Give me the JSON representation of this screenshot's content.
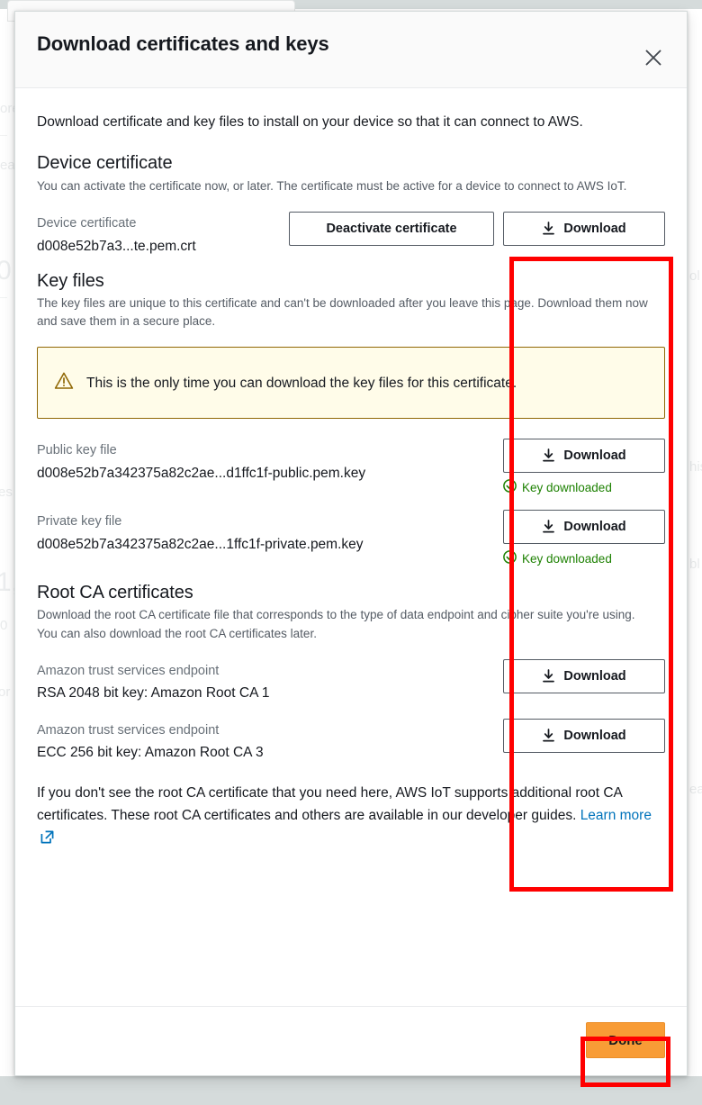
{
  "modal": {
    "title": "Download certificates and keys",
    "close_icon": "close-icon",
    "intro": "Download certificate and key files to install on your device so that it can connect to AWS."
  },
  "device_certificate": {
    "heading": "Device certificate",
    "description": "You can activate the certificate now, or later. The certificate must be active for a device to connect to AWS IoT.",
    "label": "Device certificate",
    "filename": "d008e52b7a3...te.pem.crt",
    "deactivate_button": "Deactivate certificate",
    "download_button": "Download"
  },
  "key_files": {
    "heading": "Key files",
    "description": "The key files are unique to this certificate and can't be downloaded after you leave this page. Download them now and save them in a secure place.",
    "alert": {
      "icon": "warning-triangle-icon",
      "text": "This is the only time you can download the key files for this certificate."
    },
    "items": [
      {
        "label": "Public key file",
        "filename": "d008e52b7a342375a82c2ae...d1ffc1f-public.pem.key",
        "download_button": "Download",
        "status": "Key downloaded",
        "status_icon": "check-circle-icon"
      },
      {
        "label": "Private key file",
        "filename": "d008e52b7a342375a82c2ae...1ffc1f-private.pem.key",
        "download_button": "Download",
        "status": "Key downloaded",
        "status_icon": "check-circle-icon"
      }
    ]
  },
  "root_ca": {
    "heading": "Root CA certificates",
    "description": "Download the root CA certificate file that corresponds to the type of data endpoint and cipher suite you're using. You can also download the root CA certificates later.",
    "items": [
      {
        "label": "Amazon trust services endpoint",
        "filename": "RSA 2048 bit key: Amazon Root CA 1",
        "download_button": "Download"
      },
      {
        "label": "Amazon trust services endpoint",
        "filename": "ECC 256 bit key: Amazon Root CA 3",
        "download_button": "Download"
      }
    ],
    "footnote_text": "If you don't see the root CA certificate that you need here, AWS IoT supports additional root CA certificates. These root CA certificates and others are available in our developer guides. ",
    "learn_more_label": "Learn more",
    "external_link_icon": "external-link-icon"
  },
  "footer": {
    "done_button": "Done"
  },
  "colors": {
    "primary_button": "#f89c36",
    "link": "#0073bb",
    "alert_background": "#fffce9",
    "alert_border": "#906806",
    "success_text": "#1d8102",
    "annotation": "#ff0000"
  }
}
